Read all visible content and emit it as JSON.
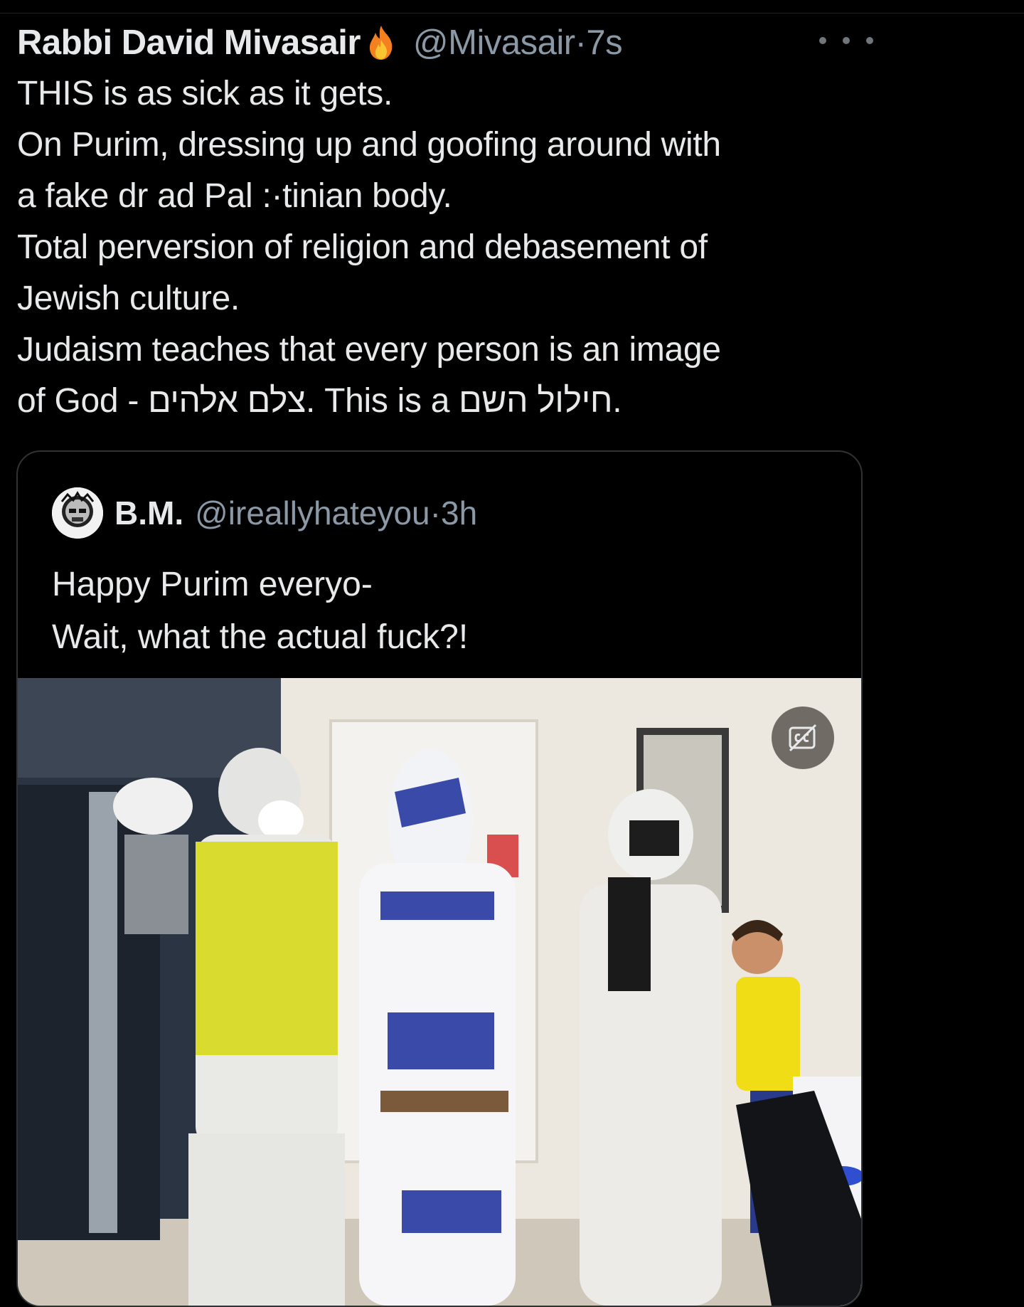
{
  "tweet": {
    "author_name": "Rabbi David Mivasair",
    "author_emoji": "flame-icon",
    "handle": "@Mivasair",
    "separator": "·",
    "time": "7s",
    "text_lines": [
      "THIS is as sick as it gets.",
      "On Purim, dressing up and goofing around with",
      "a fake dr ad Pal :·tinian body.",
      "Total perversion of religion and debasement of",
      "Jewish culture.",
      "Judaism teaches that every person is an image",
      "of God - צלם אלהים.  This is a חילול השם."
    ],
    "more_icon": "more-horizontal-icon"
  },
  "quoted_tweet": {
    "author_name": "B.M.",
    "handle": "@ireallyhateyou",
    "separator": "·",
    "time": "3h",
    "text_lines": [
      "Happy Purim everyo-",
      "Wait, what the actual fuck?!"
    ],
    "media_controls": {
      "captions_icon": "captions-off-icon"
    }
  },
  "colors": {
    "background": "#000000",
    "text_primary": "#e7e9ea",
    "text_secondary": "#8b98a5",
    "border": "#2f3336"
  }
}
